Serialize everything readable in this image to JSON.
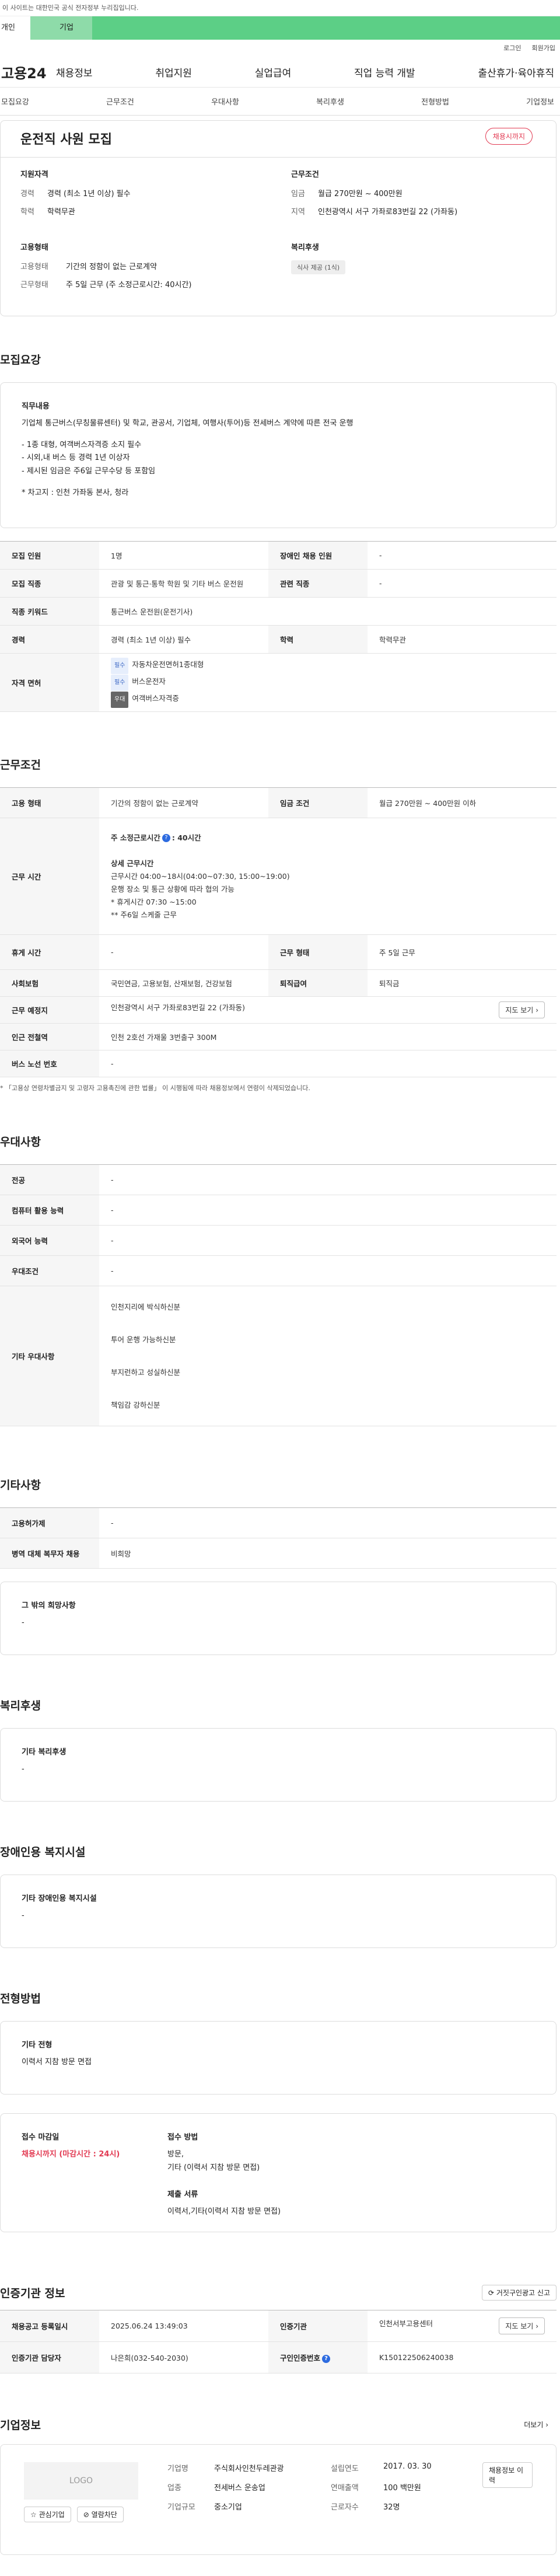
{
  "gov_notice": "이 사이트는 대한민국 공식 전자정부 누리집입니다.",
  "top_tabs": [
    "개인",
    "기업"
  ],
  "auth": [
    "로그인",
    "회원가입"
  ],
  "gnb": {
    "logo": "고용24",
    "menu": [
      "채용정보",
      "취업지원",
      "실업급여",
      "직업 능력 개발",
      "출산휴가·육아휴직"
    ]
  },
  "subnav": [
    "모집요강",
    "근무조건",
    "우대사항",
    "복리후생",
    "전형방법",
    "기업정보"
  ],
  "summary": {
    "title": "운전직 사원 모집",
    "status_pill": "채용시까지",
    "qual_title": "지원자격",
    "qual": [
      {
        "k": "경력",
        "v": "경력 (최소 1년 이상) 필수"
      },
      {
        "k": "학력",
        "v": "학력무관"
      }
    ],
    "cond_title": "근무조건",
    "cond": [
      {
        "k": "임금",
        "v": "월급 270만원 ~ 400만원"
      },
      {
        "k": "지역",
        "v": "인천광역시 서구 가좌로83번길 22 (가좌동)"
      }
    ],
    "type_title": "고용형태",
    "type": [
      {
        "k": "고용형태",
        "v": "기간의 정함이 없는 근로계약"
      },
      {
        "k": "근무형태",
        "v": "주 5일 근무 (주 소정근로시간: 40시간)"
      }
    ],
    "welfare_title": "복리후생",
    "welfare_tag": "식사 제공 (1식)"
  },
  "recruit": {
    "section_title": "모집요강",
    "job_title": "직무내용",
    "job_lines": [
      "기업체 통근버스(무칭물류센터) 및 학교, 관공서, 기업체, 여행사(투어)등 전세버스 계약에 따른 전국 운행",
      "",
      "- 1종 대형, 여객버스자격증 소지 필수",
      "- 시외,내 버스 등 경력 1년 이상자",
      "- 제시된 임금은 주6일 근무수당 등 포함임",
      "",
      "* 차고지 : 인천 가좌동 본사, 청라"
    ],
    "rows": [
      {
        "l1": "모집 인원",
        "v1": "1명",
        "l2": "장애인 채용 인원",
        "v2": "-"
      },
      {
        "l1": "모집 직종",
        "v1": "관광 및 통근·통학 학원 및 기타 버스 운전원",
        "l2": "관련 직종",
        "v2": "-"
      },
      {
        "l1": "직종 키워드",
        "v1": "통근버스 운전원(운전기사)"
      },
      {
        "l1": "경력",
        "v1": "경력 (최소 1년 이상) 필수",
        "l2": "학력",
        "v2": "학력무관"
      }
    ],
    "license_label": "자격 면허",
    "licenses": [
      {
        "badge": "필수",
        "name": "자동차운전면허1종대형"
      },
      {
        "badge": "필수",
        "name": "버스운전자"
      },
      {
        "badge": "우대",
        "name": "여객버스자격증"
      }
    ]
  },
  "work": {
    "section_title": "근무조건",
    "type_label": "고용 형태",
    "type_value": "기간의 정함이 없는 근로계약",
    "wage_label": "임금 조건",
    "wage_value": "월급 270만원 ~ 400만원 이하",
    "hours_label": "근무 시간",
    "hours_weekly": "주 소정근로시간",
    "hours_weekly_value": ": 40시간",
    "detail_title": "상세 근무시간",
    "detail_lines": [
      "근무시간 04:00~18시(04:00~07:30, 15:00~19:00)",
      "운행 장소 및 통근 상황에 따라 협의 가능",
      "* 휴게시간 07:30 ~15:00",
      "** 주6일 스케줄 근무"
    ],
    "rest_label": "휴게 시간",
    "rest_value": "-",
    "form_label": "근무 형태",
    "form_value": "주 5일 근무",
    "ins_label": "사회보험",
    "ins_value": "국민연금, 고용보험, 산재보험, 건강보험",
    "sev_label": "퇴직급여",
    "sev_value": "퇴직금",
    "loc_label": "근무 예정지",
    "loc_value": "인천광역시 서구 가좌로83번길 22 (가좌동)",
    "map_btn": "지도 보기",
    "sub_label": "인근 전철역",
    "sub_value": "인천 2호선 가재울 3번출구 300M",
    "bus_label": "버스 노선 번호",
    "bus_value": "-",
    "note": "* 「고용상 연령차별금지 및 고령자 고용촉진에 관한 법률」 이 시행됨에 따라 채용정보에서 연령이 삭제되었습니다."
  },
  "pref": {
    "section_title": "우대사항",
    "rows": [
      {
        "l": "전공",
        "v": "-"
      },
      {
        "l": "컴퓨터 활용 능력",
        "v": "-"
      },
      {
        "l": "외국어 능력",
        "v": "-"
      },
      {
        "l": "우대조건",
        "v": "-"
      }
    ],
    "other_label": "기타 우대사항",
    "other_values": [
      "인천지리에 박식하신분",
      "투어 운행 가능하신분",
      "부지런하고 성실하신분",
      "책임감 강하신분"
    ]
  },
  "etc": {
    "section_title": "기타사항",
    "rows": [
      {
        "l": "고용허가제",
        "v": "-"
      },
      {
        "l": "병역 대체 복무자 채용",
        "v": "비희망"
      }
    ],
    "box_title": "그 밖의 희망사항",
    "box_value": "-"
  },
  "welfare": {
    "section_title": "복리후생",
    "box_title": "기타 복리후생",
    "box_value": "-"
  },
  "disability": {
    "section_title": "장애인용 복지시설",
    "box_title": "기타 장애인용 복지시설",
    "box_value": "-"
  },
  "selection": {
    "section_title": "전형방법",
    "box_title": "기타 전형",
    "box_value": "이력서 지참 방문 면접",
    "deadline_label": "접수 마감일",
    "deadline_value": "채용시까지 (마감시간 : 24시)",
    "method_label": "접수 방법",
    "method_lines": [
      "방문,",
      "기타 (이력서 지참 방문 면접)"
    ],
    "docs_label": "제출 서류",
    "docs_value": "이력서,기타(이력서 지참 방문 면접)"
  },
  "agency": {
    "section_title": "인증기관 정보",
    "report_btn": "거짓구인광고 신고",
    "date_label": "채용공고 등록일시",
    "date_value": "2025.06.24 13:49:03",
    "agency_label": "인증기관",
    "agency_value": "인천서부고용센터",
    "map_btn": "지도 보기",
    "manager_label": "인증기관 담당자",
    "manager_value": "나은희(032-540-2030)",
    "id_label": "구인인증번호",
    "id_value": "K150122506240038"
  },
  "company": {
    "section_title": "기업정보",
    "more": "더보기",
    "logo": "LOGO",
    "fav_btn": "관심기업",
    "follow_btn": "열람차단",
    "name_label": "기업명",
    "name_value": "주식회사인천두레관광",
    "ind_label": "업종",
    "ind_value": "전세버스 운송업",
    "size_label": "기업규모",
    "size_value": "중소기업",
    "est_label": "설립연도",
    "est_value": "2017. 03. 30",
    "sales_label": "연매출액",
    "sales_value": "100 백만원",
    "emp_label": "근로자수",
    "emp_value": "32명",
    "jobs_btn": "채용정보 이력"
  }
}
